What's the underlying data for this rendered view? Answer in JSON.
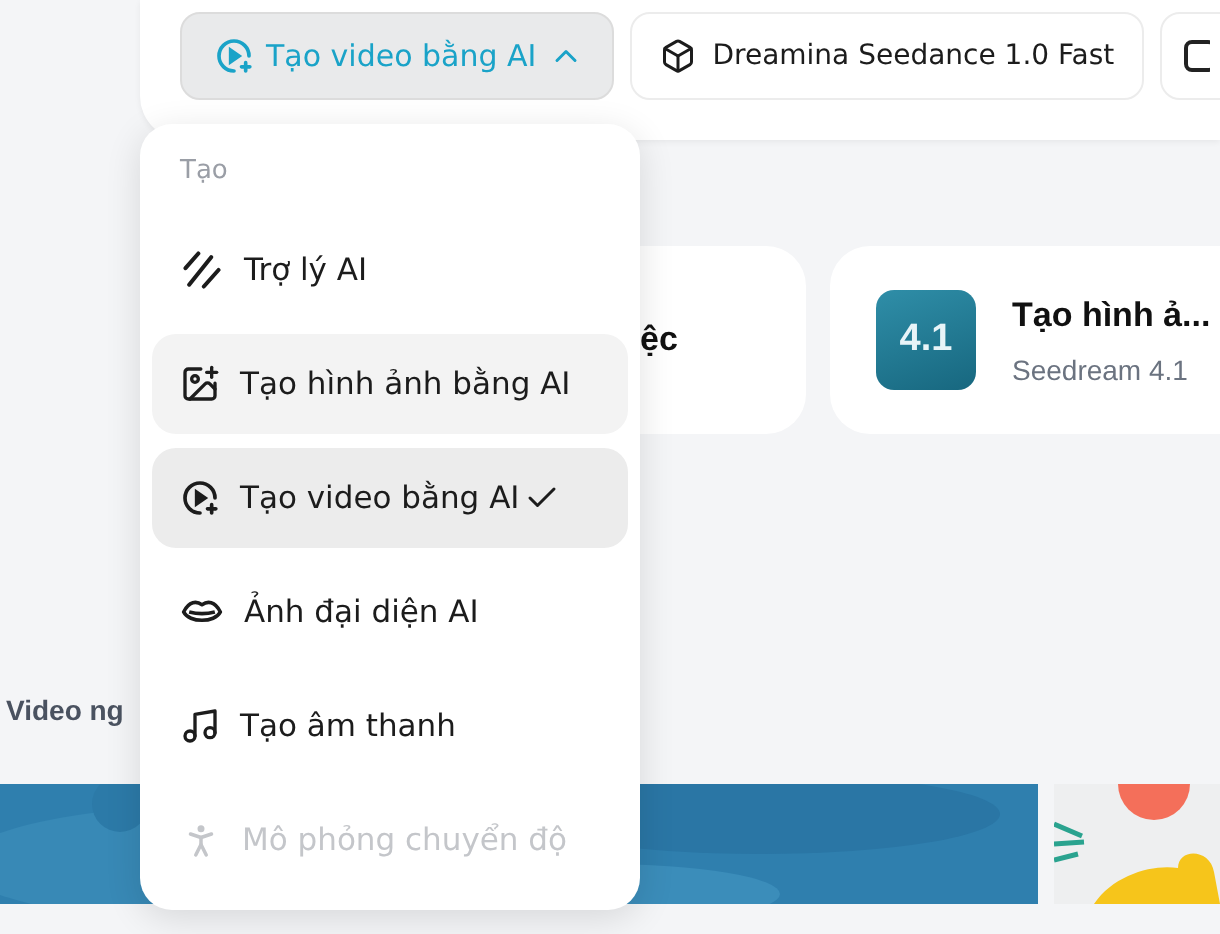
{
  "toolbar": {
    "mode_button": {
      "label": "Tạo video bằng AI",
      "expanded": true
    },
    "model_button": {
      "label": "Dreamina Seedance 1.0 Fast"
    }
  },
  "cards": [
    {
      "title": "ệc"
    },
    {
      "title": "Tạo hình ả...",
      "subtitle": "Seedream 4.1",
      "badge": "4.1"
    }
  ],
  "section_label": "Video ng",
  "menu": {
    "heading": "Tạo",
    "items": [
      {
        "label": "Trợ lý AI",
        "selected": false,
        "hovered": false,
        "disabled": false
      },
      {
        "label": "Tạo hình ảnh bằng AI",
        "selected": false,
        "hovered": true,
        "disabled": false
      },
      {
        "label": "Tạo video bằng AI",
        "selected": true,
        "hovered": false,
        "disabled": false
      },
      {
        "label": "Ảnh đại diện AI",
        "selected": false,
        "hovered": false,
        "disabled": false
      },
      {
        "label": "Tạo âm thanh",
        "selected": false,
        "hovered": false,
        "disabled": false
      },
      {
        "label": "Mô phỏng chuyển độ",
        "selected": false,
        "hovered": false,
        "disabled": true
      }
    ]
  }
}
